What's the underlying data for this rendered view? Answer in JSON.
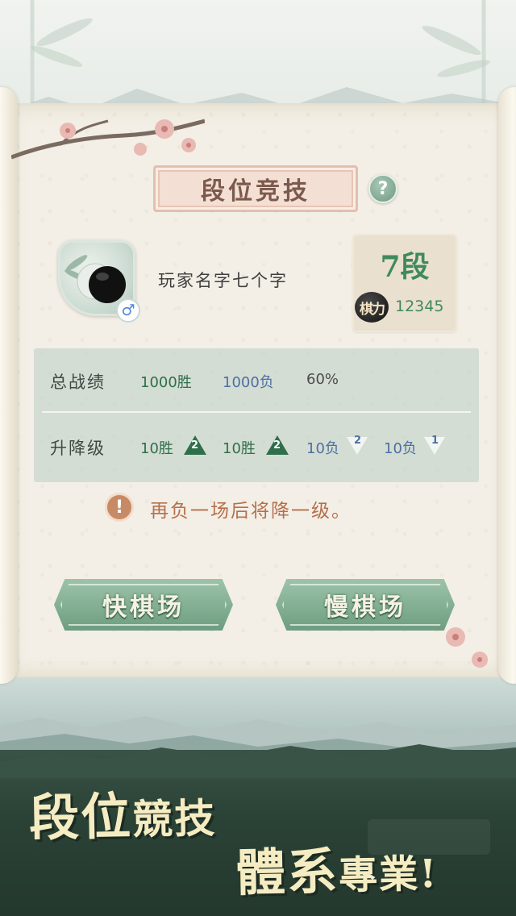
{
  "title": "段位竞技",
  "help_icon": "question-icon",
  "player": {
    "name": "玩家名字七个字",
    "gender_symbol": "♂",
    "rank": "7段",
    "power_label": "棋力",
    "power_value": "12345"
  },
  "stats": {
    "total_label": "总战绩",
    "total_wins": "1000胜",
    "total_losses": "1000负",
    "win_rate": "60%",
    "promo_label": "升降级",
    "promo_items": [
      {
        "text": "10胜",
        "arrow": "up",
        "count": "2"
      },
      {
        "text": "10胜",
        "arrow": "up",
        "count": "2"
      },
      {
        "text": "10负",
        "arrow": "down",
        "count": "2"
      },
      {
        "text": "10负",
        "arrow": "down",
        "count": "1"
      }
    ]
  },
  "warning": {
    "icon": "!",
    "text": "再负一场后将降一级。"
  },
  "buttons": {
    "quick": "快棋场",
    "slow": "慢棋场"
  },
  "slogan": {
    "line1_big": "段位",
    "line1_small": "競技",
    "line2_big": "體系",
    "line2_small": "專業!"
  },
  "colors": {
    "accent_green": "#3f8a5c",
    "loss_blue": "#4d6fa2",
    "warning_orange": "#b56f4c"
  }
}
